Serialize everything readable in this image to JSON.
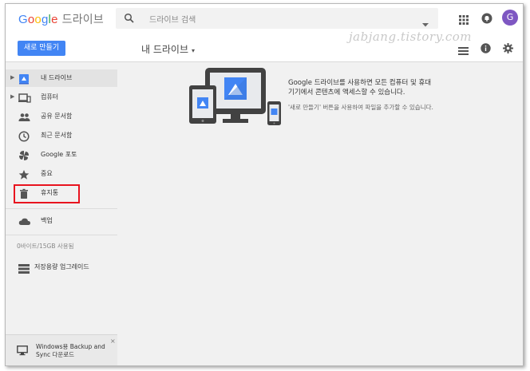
{
  "header": {
    "logo_google": [
      "G",
      "o",
      "o",
      "g",
      "l",
      "e"
    ],
    "logo_drive": "드라이브",
    "search_placeholder": "드라이브 검색",
    "avatar_initial": "G"
  },
  "toolbar": {
    "new_button": "새로 만들기",
    "title": "내 드라이브",
    "title_caret": "▾",
    "watermark": "jabjang.tistory.com"
  },
  "sidebar": {
    "items": [
      {
        "label": "내 드라이브",
        "icon": "drive-folder-icon",
        "expandable": true,
        "active": true
      },
      {
        "label": "컴퓨터",
        "icon": "computers-icon",
        "expandable": true,
        "active": false
      },
      {
        "label": "공유 문서함",
        "icon": "shared-people-icon",
        "expandable": false,
        "active": false
      },
      {
        "label": "최근 문서함",
        "icon": "clock-icon",
        "expandable": false,
        "active": false
      },
      {
        "label": "Google 포토",
        "icon": "photos-pinwheel-icon",
        "expandable": false,
        "active": false
      },
      {
        "label": "중요",
        "icon": "star-icon",
        "expandable": false,
        "active": false
      },
      {
        "label": "휴지통",
        "icon": "trash-icon",
        "expandable": false,
        "active": false
      },
      {
        "label": "백업",
        "icon": "cloud-icon",
        "expandable": false,
        "active": false
      }
    ],
    "storage_text": "0바이트/15GB 사용됨",
    "upgrade_label": "저장용량 업그레이드",
    "promo_line1": "Windows용 Backup and",
    "promo_line2": "Sync 다운로드",
    "promo_close": "×"
  },
  "main": {
    "message_line1": "Google 드라이브를 사용하면 모든 컴퓨터 및 휴대",
    "message_line2": "기기에서 콘텐츠에 액세스할 수 있습니다.",
    "message_hint": "'새로 만들기' 버튼을 사용하여 파일을 추가할 수 있습니다."
  },
  "colors": {
    "accent": "#4285f4",
    "highlight_box": "#e8141f",
    "avatar": "#7e57c2"
  }
}
